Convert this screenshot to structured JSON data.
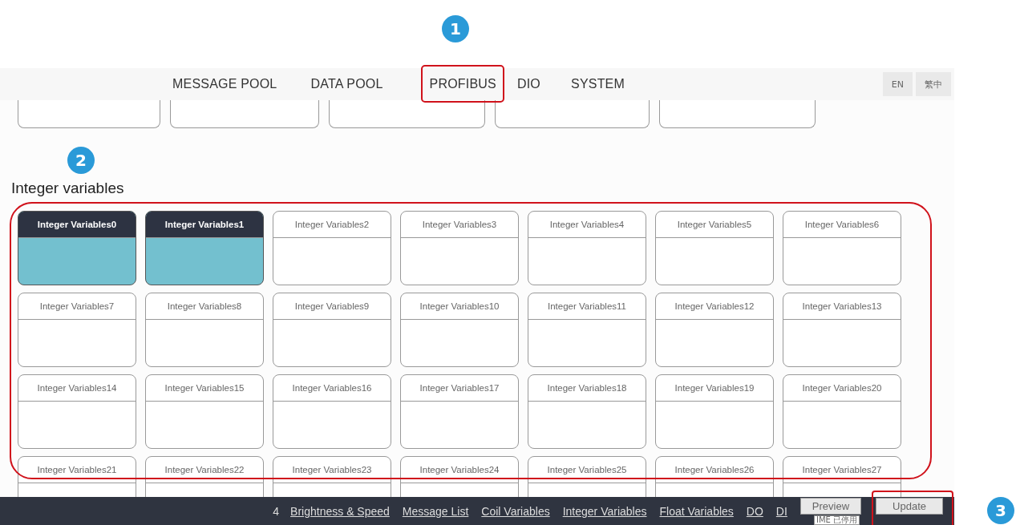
{
  "nav": {
    "tabs": [
      {
        "label": "MESSAGE POOL"
      },
      {
        "label": "DATA POOL"
      },
      {
        "label": "PROFIBUS"
      },
      {
        "label": "DIO"
      },
      {
        "label": "SYSTEM"
      }
    ],
    "languages": [
      {
        "label": "EN"
      },
      {
        "label": "繁中"
      }
    ]
  },
  "section": {
    "title": "Integer variables",
    "cards": [
      {
        "label": "Integer Variables0",
        "selected": true
      },
      {
        "label": "Integer Variables1",
        "selected": true
      },
      {
        "label": "Integer Variables2",
        "selected": false
      },
      {
        "label": "Integer Variables3",
        "selected": false
      },
      {
        "label": "Integer Variables4",
        "selected": false
      },
      {
        "label": "Integer Variables5",
        "selected": false
      },
      {
        "label": "Integer Variables6",
        "selected": false
      },
      {
        "label": "Integer Variables7",
        "selected": false
      },
      {
        "label": "Integer Variables8",
        "selected": false
      },
      {
        "label": "Integer Variables9",
        "selected": false
      },
      {
        "label": "Integer Variables10",
        "selected": false
      },
      {
        "label": "Integer Variables11",
        "selected": false
      },
      {
        "label": "Integer Variables12",
        "selected": false
      },
      {
        "label": "Integer Variables13",
        "selected": false
      },
      {
        "label": "Integer Variables14",
        "selected": false
      },
      {
        "label": "Integer Variables15",
        "selected": false
      },
      {
        "label": "Integer Variables16",
        "selected": false
      },
      {
        "label": "Integer Variables17",
        "selected": false
      },
      {
        "label": "Integer Variables18",
        "selected": false
      },
      {
        "label": "Integer Variables19",
        "selected": false
      },
      {
        "label": "Integer Variables20",
        "selected": false
      },
      {
        "label": "Integer Variables21",
        "selected": false
      },
      {
        "label": "Integer Variables22",
        "selected": false
      },
      {
        "label": "Integer Variables23",
        "selected": false
      },
      {
        "label": "Integer Variables24",
        "selected": false
      },
      {
        "label": "Integer Variables25",
        "selected": false
      },
      {
        "label": "Integer Variables26",
        "selected": false
      },
      {
        "label": "Integer Variables27",
        "selected": false
      }
    ]
  },
  "bottom_bar": {
    "page": "4",
    "links": [
      "Brightness & Speed",
      "Message List",
      "Coil Variables",
      "Integer Variables",
      "Float Variables",
      "DO",
      "DI"
    ],
    "buttons": [
      "Preview",
      "Update"
    ],
    "tooltip": "IME 已停用"
  },
  "annotations": [
    "1",
    "2",
    "3"
  ]
}
